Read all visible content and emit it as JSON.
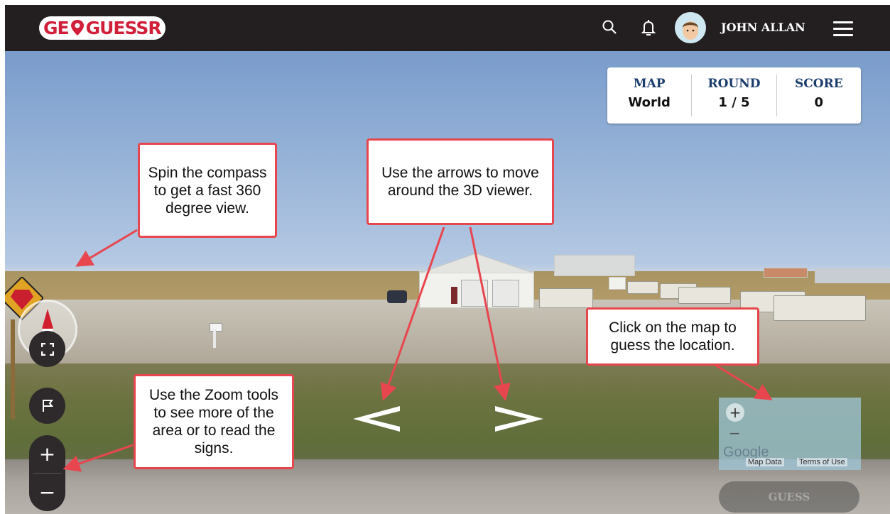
{
  "app": {
    "logo_text_left": "GE",
    "logo_text_right": "GUESSR",
    "brand_color": "#d11f3a"
  },
  "header": {
    "username": "JOHN ALLAN",
    "icons": [
      "search-icon",
      "bell-icon",
      "avatar",
      "hamburger-icon"
    ]
  },
  "scoreboard": {
    "map_label": "MAP",
    "map_value": "World",
    "round_label": "ROUND",
    "round_value": "1 / 5",
    "score_label": "SCORE",
    "score_value": "0"
  },
  "callouts": {
    "compass": "Spin the compass to get a fast 360 degree view.",
    "arrows": "Use the arrows to move around the 3D viewer.",
    "map": "Click on the map to guess the location.",
    "zoom": "Use the Zoom tools to see more of the area or to read the signs."
  },
  "controls": {
    "zoom_in": "+",
    "zoom_out": "−"
  },
  "minimap": {
    "zoom_in": "+",
    "zoom_out": "−",
    "map_data": "Map Data",
    "terms": "Terms of Use",
    "google": "Google"
  },
  "guess_button": {
    "label": "GUESS"
  },
  "colors": {
    "callout_border": "#e8464e",
    "arrow": "#e8464e",
    "header_bg": "#231f20"
  }
}
